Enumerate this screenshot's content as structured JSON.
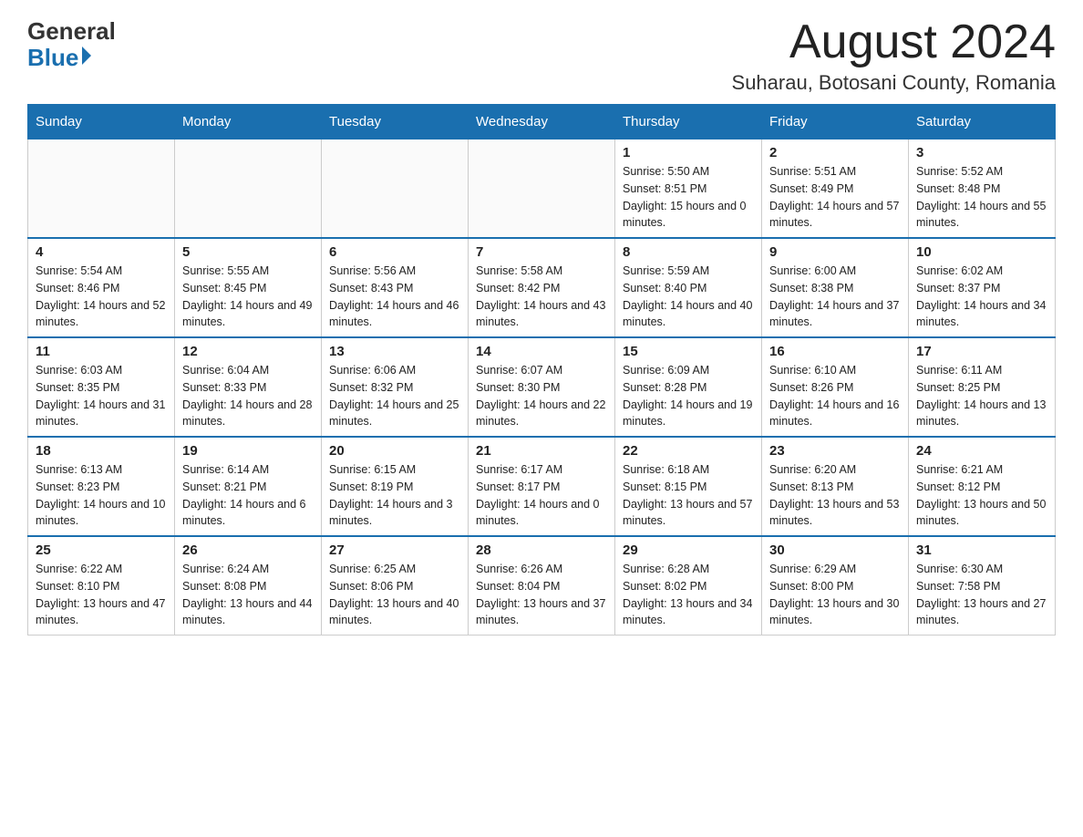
{
  "header": {
    "logo": {
      "general": "General",
      "triangle": "▶",
      "blue": "Blue"
    },
    "title": "August 2024",
    "location": "Suharau, Botosani County, Romania"
  },
  "days_of_week": [
    "Sunday",
    "Monday",
    "Tuesday",
    "Wednesday",
    "Thursday",
    "Friday",
    "Saturday"
  ],
  "weeks": [
    {
      "days": [
        {
          "number": "",
          "info": ""
        },
        {
          "number": "",
          "info": ""
        },
        {
          "number": "",
          "info": ""
        },
        {
          "number": "",
          "info": ""
        },
        {
          "number": "1",
          "info": "Sunrise: 5:50 AM\nSunset: 8:51 PM\nDaylight: 15 hours and 0 minutes."
        },
        {
          "number": "2",
          "info": "Sunrise: 5:51 AM\nSunset: 8:49 PM\nDaylight: 14 hours and 57 minutes."
        },
        {
          "number": "3",
          "info": "Sunrise: 5:52 AM\nSunset: 8:48 PM\nDaylight: 14 hours and 55 minutes."
        }
      ]
    },
    {
      "days": [
        {
          "number": "4",
          "info": "Sunrise: 5:54 AM\nSunset: 8:46 PM\nDaylight: 14 hours and 52 minutes."
        },
        {
          "number": "5",
          "info": "Sunrise: 5:55 AM\nSunset: 8:45 PM\nDaylight: 14 hours and 49 minutes."
        },
        {
          "number": "6",
          "info": "Sunrise: 5:56 AM\nSunset: 8:43 PM\nDaylight: 14 hours and 46 minutes."
        },
        {
          "number": "7",
          "info": "Sunrise: 5:58 AM\nSunset: 8:42 PM\nDaylight: 14 hours and 43 minutes."
        },
        {
          "number": "8",
          "info": "Sunrise: 5:59 AM\nSunset: 8:40 PM\nDaylight: 14 hours and 40 minutes."
        },
        {
          "number": "9",
          "info": "Sunrise: 6:00 AM\nSunset: 8:38 PM\nDaylight: 14 hours and 37 minutes."
        },
        {
          "number": "10",
          "info": "Sunrise: 6:02 AM\nSunset: 8:37 PM\nDaylight: 14 hours and 34 minutes."
        }
      ]
    },
    {
      "days": [
        {
          "number": "11",
          "info": "Sunrise: 6:03 AM\nSunset: 8:35 PM\nDaylight: 14 hours and 31 minutes."
        },
        {
          "number": "12",
          "info": "Sunrise: 6:04 AM\nSunset: 8:33 PM\nDaylight: 14 hours and 28 minutes."
        },
        {
          "number": "13",
          "info": "Sunrise: 6:06 AM\nSunset: 8:32 PM\nDaylight: 14 hours and 25 minutes."
        },
        {
          "number": "14",
          "info": "Sunrise: 6:07 AM\nSunset: 8:30 PM\nDaylight: 14 hours and 22 minutes."
        },
        {
          "number": "15",
          "info": "Sunrise: 6:09 AM\nSunset: 8:28 PM\nDaylight: 14 hours and 19 minutes."
        },
        {
          "number": "16",
          "info": "Sunrise: 6:10 AM\nSunset: 8:26 PM\nDaylight: 14 hours and 16 minutes."
        },
        {
          "number": "17",
          "info": "Sunrise: 6:11 AM\nSunset: 8:25 PM\nDaylight: 14 hours and 13 minutes."
        }
      ]
    },
    {
      "days": [
        {
          "number": "18",
          "info": "Sunrise: 6:13 AM\nSunset: 8:23 PM\nDaylight: 14 hours and 10 minutes."
        },
        {
          "number": "19",
          "info": "Sunrise: 6:14 AM\nSunset: 8:21 PM\nDaylight: 14 hours and 6 minutes."
        },
        {
          "number": "20",
          "info": "Sunrise: 6:15 AM\nSunset: 8:19 PM\nDaylight: 14 hours and 3 minutes."
        },
        {
          "number": "21",
          "info": "Sunrise: 6:17 AM\nSunset: 8:17 PM\nDaylight: 14 hours and 0 minutes."
        },
        {
          "number": "22",
          "info": "Sunrise: 6:18 AM\nSunset: 8:15 PM\nDaylight: 13 hours and 57 minutes."
        },
        {
          "number": "23",
          "info": "Sunrise: 6:20 AM\nSunset: 8:13 PM\nDaylight: 13 hours and 53 minutes."
        },
        {
          "number": "24",
          "info": "Sunrise: 6:21 AM\nSunset: 8:12 PM\nDaylight: 13 hours and 50 minutes."
        }
      ]
    },
    {
      "days": [
        {
          "number": "25",
          "info": "Sunrise: 6:22 AM\nSunset: 8:10 PM\nDaylight: 13 hours and 47 minutes."
        },
        {
          "number": "26",
          "info": "Sunrise: 6:24 AM\nSunset: 8:08 PM\nDaylight: 13 hours and 44 minutes."
        },
        {
          "number": "27",
          "info": "Sunrise: 6:25 AM\nSunset: 8:06 PM\nDaylight: 13 hours and 40 minutes."
        },
        {
          "number": "28",
          "info": "Sunrise: 6:26 AM\nSunset: 8:04 PM\nDaylight: 13 hours and 37 minutes."
        },
        {
          "number": "29",
          "info": "Sunrise: 6:28 AM\nSunset: 8:02 PM\nDaylight: 13 hours and 34 minutes."
        },
        {
          "number": "30",
          "info": "Sunrise: 6:29 AM\nSunset: 8:00 PM\nDaylight: 13 hours and 30 minutes."
        },
        {
          "number": "31",
          "info": "Sunrise: 6:30 AM\nSunset: 7:58 PM\nDaylight: 13 hours and 27 minutes."
        }
      ]
    }
  ]
}
